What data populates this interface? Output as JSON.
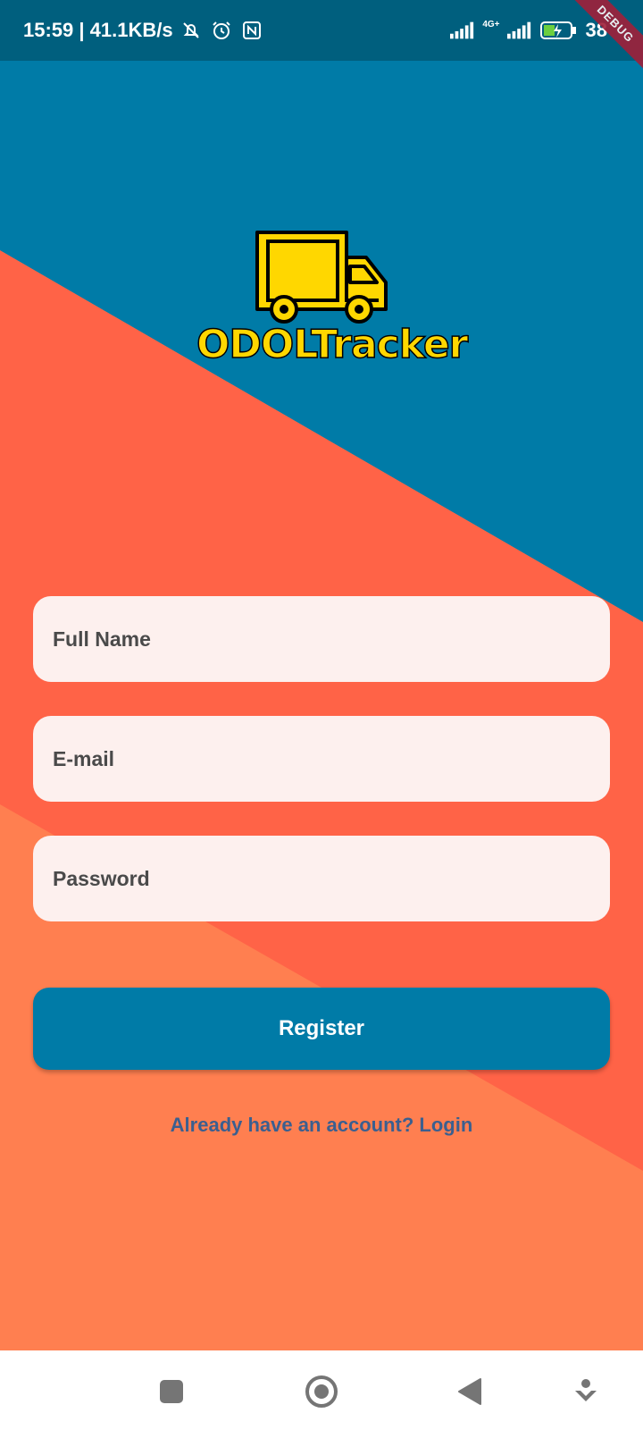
{
  "colors": {
    "status_bar": "#005f7e",
    "top_band": "#007ba7",
    "middle_band": "#ff6347",
    "bottom_band": "#ff7f50",
    "logo_yellow": "#ffd700",
    "field_background": "#fdf0ee",
    "button": "#007ba7",
    "link": "#3b5f8f"
  },
  "status_bar": {
    "time_and_speed": "15:59 | 41.1KB/s",
    "network_label": "4G+",
    "battery_percent": "38",
    "icons": [
      "mute-bell-icon",
      "alarm-icon",
      "nfc-icon",
      "signal-icon",
      "signal-4g-icon",
      "battery-charging-icon"
    ]
  },
  "debug_banner": "DEBUG",
  "logo": {
    "icon": "truck-icon",
    "text": "ODOLTracker"
  },
  "form": {
    "full_name_placeholder": "Full Name",
    "email_placeholder": "E-mail",
    "password_placeholder": "Password",
    "submit_label": "Register",
    "login_link": "Already have an account? Login"
  },
  "nav_bar": {
    "icons": [
      "recent-apps-icon",
      "home-icon",
      "back-icon",
      "assistant-icon"
    ]
  }
}
